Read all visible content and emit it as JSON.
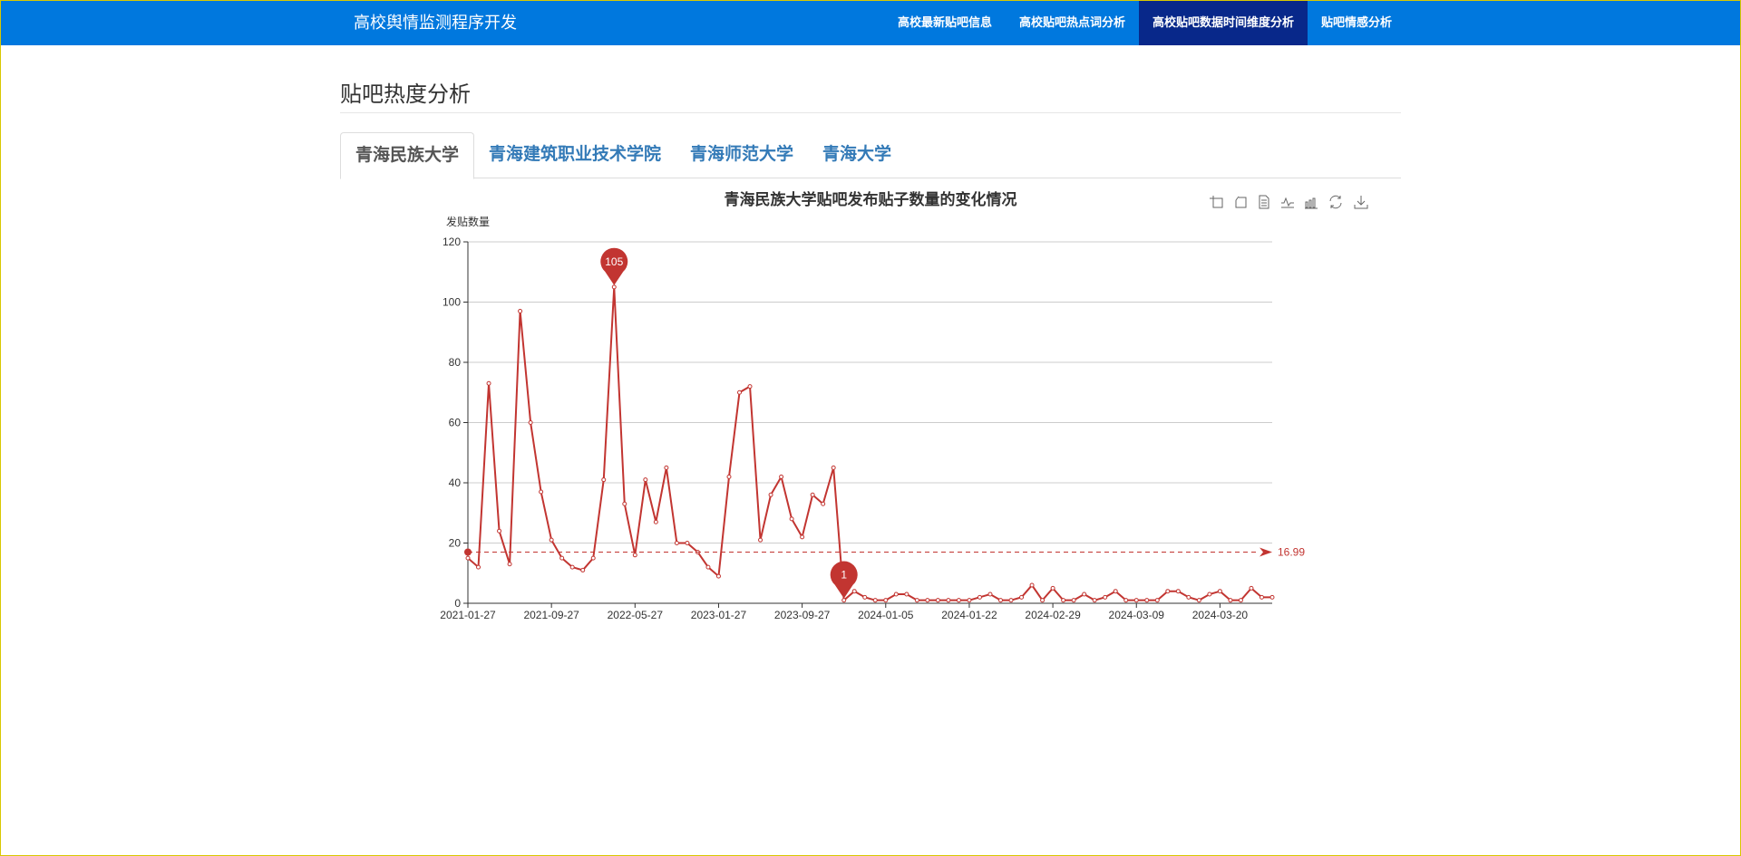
{
  "navbar": {
    "brand": "高校舆情监测程序开发",
    "items": [
      {
        "label": "高校最新贴吧信息",
        "active": false
      },
      {
        "label": "高校贴吧热点词分析",
        "active": false
      },
      {
        "label": "高校贴吧数据时间维度分析",
        "active": true
      },
      {
        "label": "贴吧情感分析",
        "active": false
      }
    ]
  },
  "page_title": "贴吧热度分析",
  "tabs": [
    {
      "label": "青海民族大学",
      "active": true
    },
    {
      "label": "青海建筑职业技术学院",
      "active": false
    },
    {
      "label": "青海师范大学",
      "active": false
    },
    {
      "label": "青海大学",
      "active": false
    }
  ],
  "toolbox": [
    "data-zoom-icon",
    "zoom-reset-icon",
    "data-view-icon",
    "line-chart-icon",
    "bar-chart-icon",
    "restore-icon",
    "save-image-icon"
  ],
  "chart_data": {
    "type": "line",
    "title": "青海民族大学贴吧发布贴子数量的变化情况",
    "ylabel": "发贴数量",
    "xlabel": "",
    "ylim": [
      0,
      120
    ],
    "yticks": [
      "0",
      "20",
      "40",
      "60",
      "80",
      "100",
      "120"
    ],
    "grid": true,
    "color": "#c23531",
    "x_tick_labels": [
      "2021-01-27",
      "2021-09-27",
      "2022-05-27",
      "2023-01-27",
      "2023-09-27",
      "2024-01-05",
      "2024-01-22",
      "2024-02-29",
      "2024-03-09",
      "2024-03-20"
    ],
    "x_tick_every": 8,
    "values": [
      15,
      12,
      73,
      24,
      13,
      97,
      60,
      37,
      21,
      15,
      12,
      11,
      15,
      41,
      105,
      33,
      16,
      41,
      27,
      45,
      20,
      20,
      17,
      12,
      9,
      42,
      70,
      72,
      21,
      36,
      42,
      28,
      22,
      36,
      33,
      45,
      1,
      4,
      2,
      1,
      1,
      3,
      3,
      1,
      1,
      1,
      1,
      1,
      1,
      2,
      3,
      1,
      1,
      2,
      6,
      1,
      5,
      1,
      1,
      3,
      1,
      2,
      4,
      1,
      1,
      1,
      1,
      4,
      4,
      2,
      1,
      3,
      4,
      1,
      1,
      5,
      2,
      2
    ],
    "mark_points": [
      {
        "type": "max",
        "label": "105"
      },
      {
        "type": "min",
        "label": "1"
      }
    ],
    "mark_line": {
      "type": "average",
      "label": "16.99",
      "value": 16.99
    }
  }
}
